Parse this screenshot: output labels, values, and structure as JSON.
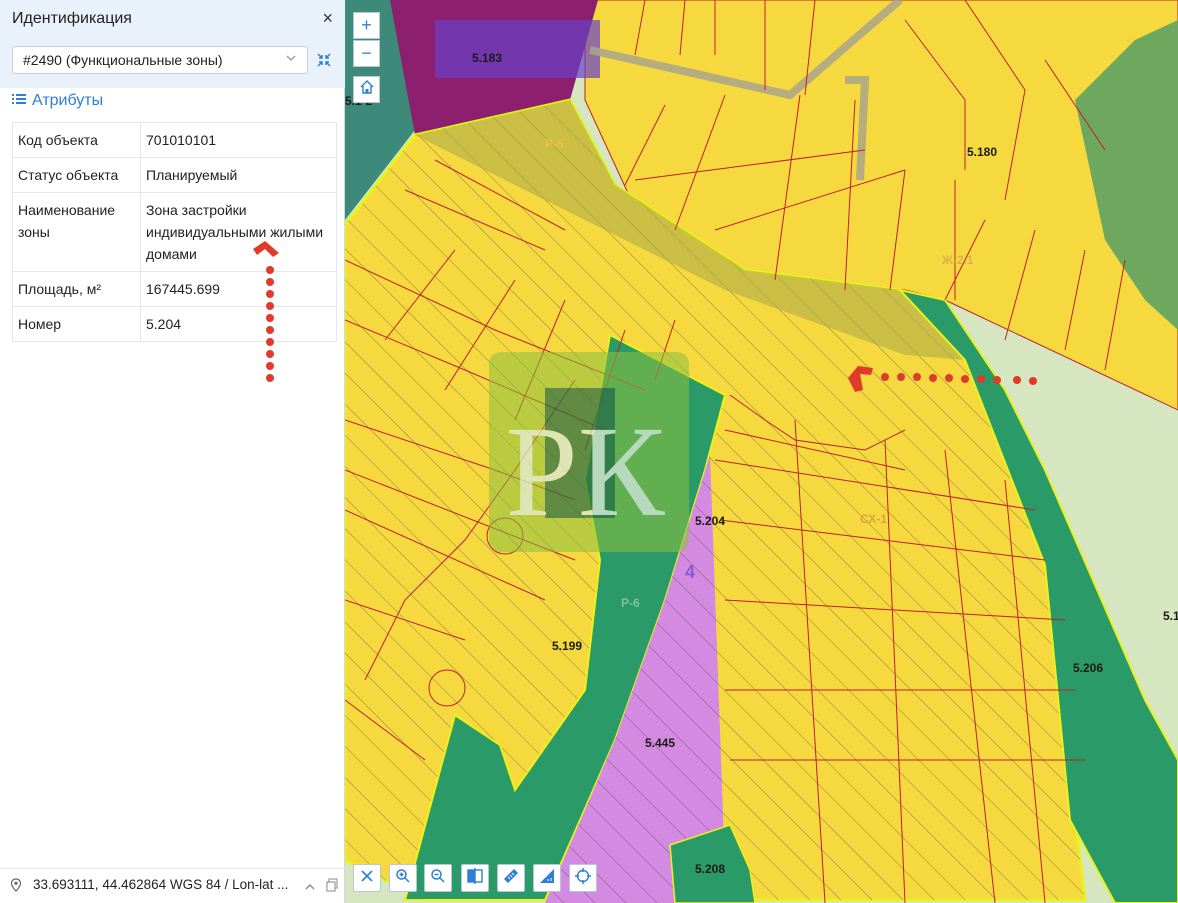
{
  "panel": {
    "title": "Идентификация",
    "close_label": "×",
    "layer_select_value": "#2490 (Функциональные зоны)",
    "attributes_heading": "Атрибуты",
    "attributes": [
      {
        "key": "Код объекта",
        "value": "701010101"
      },
      {
        "key": "Статус объекта",
        "value": "Планируемый"
      },
      {
        "key": "Наименование зоны",
        "value": "Зона застройки индивидуальными жилыми домами"
      },
      {
        "key": "Площадь, м²",
        "value": "167445.699"
      },
      {
        "key": "Номер",
        "value": "5.204"
      }
    ]
  },
  "status_bar": {
    "coordinates": "33.693111, 44.462864 WGS 84 / Lon-lat ..."
  },
  "map": {
    "zoom_in_label": "+",
    "zoom_out_label": "−",
    "labels": {
      "z5183": "5.183",
      "z5180": "5.180",
      "zone_r5": "Р-5",
      "zone_zh21": "Ж-2.1",
      "z5204": "5.204",
      "zone_sx1": "СХ-1",
      "zone_r6": "Р-6",
      "z5199": "5.199",
      "z5206": "5.206",
      "z5445": "5.445",
      "z5208": "5.208",
      "num4": "4",
      "edge_left": "5.1·2",
      "edge_right": "5.1"
    },
    "watermark": "РК"
  },
  "colors": {
    "accent": "#2b7fd4",
    "residential_yellow": "#f5d93f",
    "green_zone": "#2a9a68",
    "purple_zone": "#d48ae0",
    "dark_magenta": "#8c1f6e",
    "light_green": "#d6e6c0",
    "annotation_red": "#e03a2a"
  },
  "icons": [
    "close-icon",
    "chevron-down-icon",
    "collapse-icon",
    "list-icon",
    "location-pin-icon",
    "chevron-up-icon",
    "copy-icon",
    "home-icon",
    "clear-icon",
    "zoom-in-icon",
    "zoom-out-icon",
    "compare-icon",
    "ruler-icon",
    "area-measure-icon",
    "locate-icon"
  ]
}
